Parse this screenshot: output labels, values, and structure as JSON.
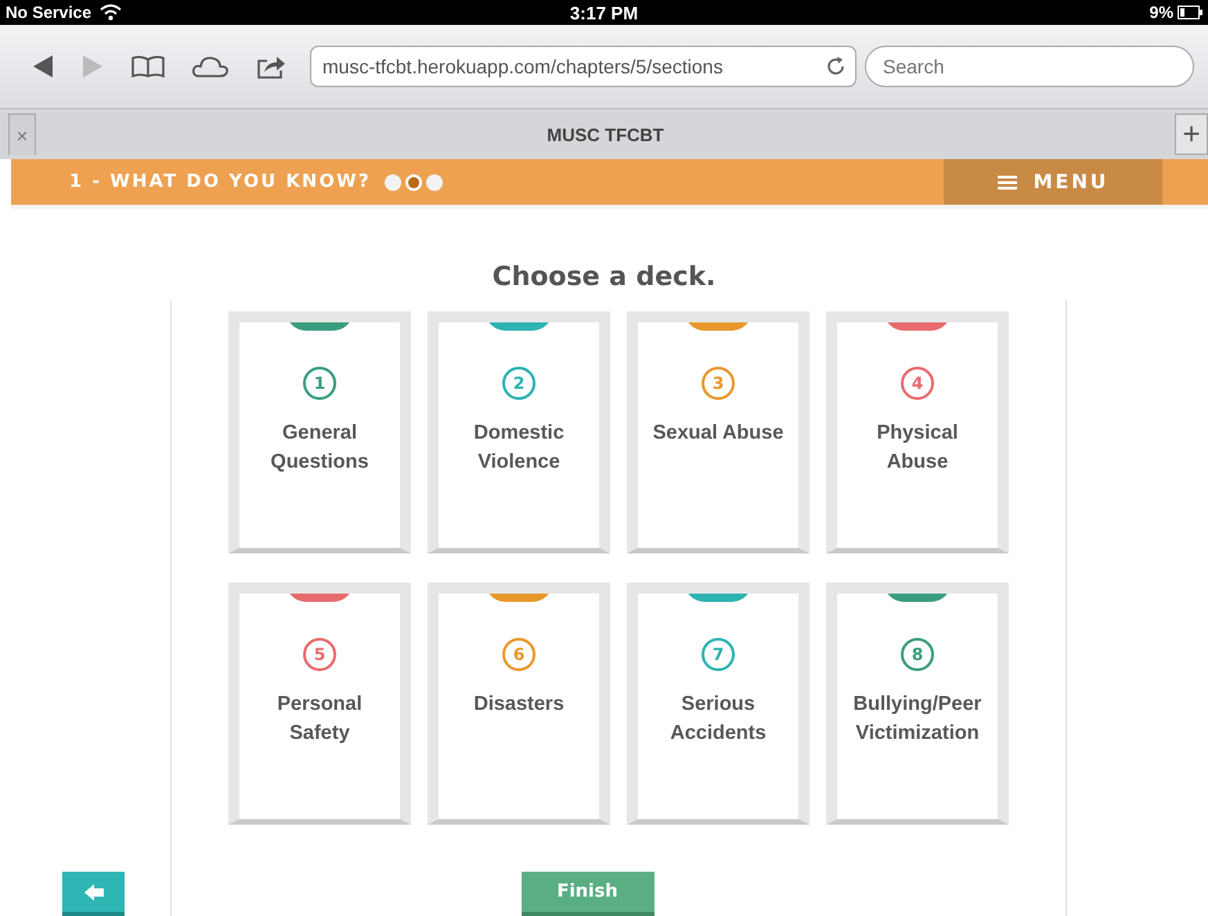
{
  "status_bar": {
    "carrier": "No Service",
    "time": "3:17 PM",
    "battery": "9%"
  },
  "browser": {
    "url": "musc-tfcbt.herokuapp.com/chapters/5/sections",
    "search": {
      "placeholder": "Search"
    },
    "tab_title": "MUSC TFCBT",
    "close_tab": "×",
    "new_tab": "+"
  },
  "header": {
    "title": "1 - WHAT DO YOU KNOW?",
    "progress": [
      {
        "selected": false
      },
      {
        "selected": true
      },
      {
        "selected": false
      }
    ],
    "menu": "MENU"
  },
  "heading": "Choose a deck.",
  "decks": [
    {
      "number": "1",
      "title": "General Questions",
      "color": "#3a9d7f"
    },
    {
      "number": "2",
      "title": "Domestic Violence",
      "color": "#2db3b1"
    },
    {
      "number": "3",
      "title": "Sexual Abuse",
      "color": "#e8982a"
    },
    {
      "number": "4",
      "title": "Physical Abuse",
      "color": "#e86b6d"
    },
    {
      "number": "5",
      "title": "Personal Safety",
      "color": "#e86b6d"
    },
    {
      "number": "6",
      "title": "Disasters",
      "color": "#e8982a"
    },
    {
      "number": "7",
      "title": "Serious Accidents",
      "color": "#2db3b1"
    },
    {
      "number": "8",
      "title": "Bullying/Peer Victimization",
      "color": "#3a9d7f"
    }
  ],
  "finish": "Finish"
}
